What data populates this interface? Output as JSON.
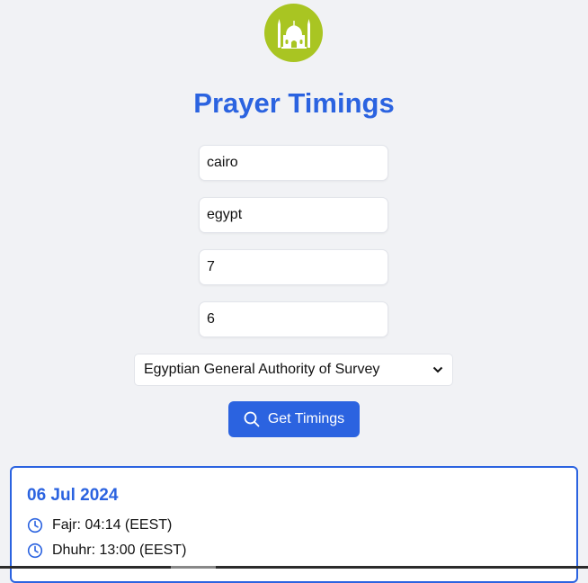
{
  "header": {
    "title": "Prayer Timings",
    "logo_icon": "mosque-icon",
    "logo_color": "#a9c522"
  },
  "form": {
    "city_value": "cairo",
    "country_value": "egypt",
    "month_value": "7",
    "day_value": "6",
    "method_selected": "Egyptian General Authority of Survey",
    "submit_label": "Get Timings"
  },
  "result": {
    "date": "06 Jul 2024",
    "prayers": [
      {
        "text": "Fajr: 04:14 (EEST)",
        "icon": "clock-icon"
      },
      {
        "text": "Dhuhr: 13:00 (EEST)",
        "icon": "clock-icon"
      }
    ]
  },
  "colors": {
    "accent": "#2b63e0",
    "background": "#f1f2f5"
  }
}
